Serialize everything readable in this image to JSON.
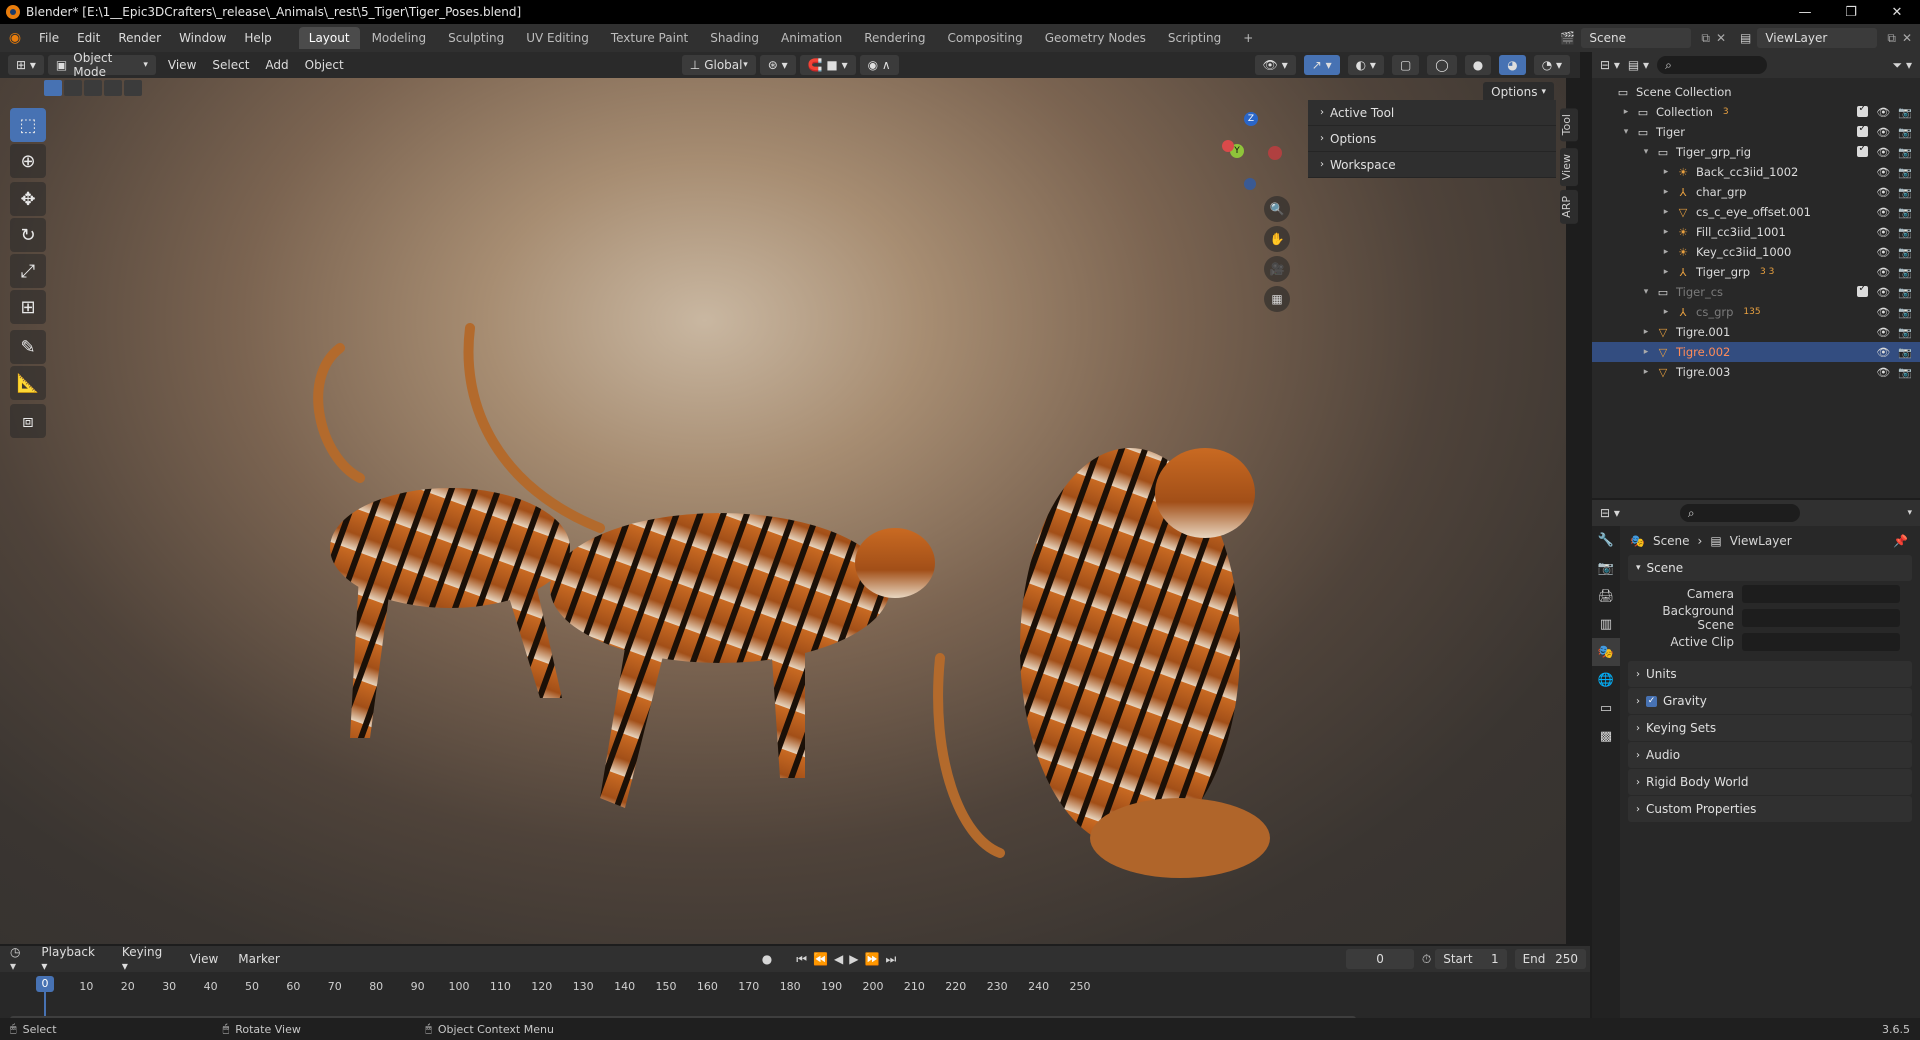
{
  "window": {
    "title": "Blender* [E:\\1__Epic3DCrafters\\_release\\_Animals\\_rest\\5_Tiger\\Tiger_Poses.blend]"
  },
  "menu": [
    "File",
    "Edit",
    "Render",
    "Window",
    "Help"
  ],
  "workspaces": [
    "Layout",
    "Modeling",
    "Sculpting",
    "UV Editing",
    "Texture Paint",
    "Shading",
    "Animation",
    "Rendering",
    "Compositing",
    "Geometry Nodes",
    "Scripting"
  ],
  "active_workspace": "Layout",
  "scene_field": "Scene",
  "viewlayer_field": "ViewLayer",
  "viewport_header": {
    "mode": "Object Mode",
    "menus": [
      "View",
      "Select",
      "Add",
      "Object"
    ],
    "orientation": "Global",
    "options_label": "Options"
  },
  "npanel": {
    "rows": [
      "Active Tool",
      "Options",
      "Workspace"
    ],
    "tabs": [
      "Tool",
      "View",
      "ARP"
    ]
  },
  "outliner": {
    "rows": [
      {
        "label": "Scene Collection",
        "icon": "collection-icon",
        "depth": 0,
        "expand": ""
      },
      {
        "label": "Collection",
        "icon": "collection-icon",
        "depth": 1,
        "expand": "▸",
        "badge": "3"
      },
      {
        "label": "Tiger",
        "icon": "collection-icon",
        "depth": 1,
        "expand": "▾"
      },
      {
        "label": "Tiger_grp_rig",
        "icon": "collection-icon",
        "depth": 2,
        "expand": "▾"
      },
      {
        "label": "Back_cc3iid_1002",
        "icon": "light-icon",
        "depth": 3,
        "expand": "▸"
      },
      {
        "label": "char_grp",
        "icon": "armature-icon",
        "depth": 3,
        "expand": "▸"
      },
      {
        "label": "cs_c_eye_offset.001",
        "icon": "mesh-icon",
        "depth": 3,
        "expand": "▸"
      },
      {
        "label": "Fill_cc3iid_1001",
        "icon": "light-icon",
        "depth": 3,
        "expand": "▸"
      },
      {
        "label": "Key_cc3iid_1000",
        "icon": "light-icon",
        "depth": 3,
        "expand": "▸"
      },
      {
        "label": "Tiger_grp",
        "icon": "armature-icon",
        "depth": 3,
        "expand": "▸",
        "badge": "3 3"
      },
      {
        "label": "Tiger_cs",
        "icon": "collection-icon",
        "depth": 2,
        "expand": "▾",
        "dim": true
      },
      {
        "label": "cs_grp",
        "icon": "armature-icon",
        "depth": 3,
        "expand": "▸",
        "dim": true,
        "badge": "135"
      },
      {
        "label": "Tigre.001",
        "icon": "mesh-icon",
        "depth": 2,
        "expand": "▸"
      },
      {
        "label": "Tigre.002",
        "icon": "mesh-icon",
        "depth": 2,
        "expand": "▸",
        "selected": true
      },
      {
        "label": "Tigre.003",
        "icon": "mesh-icon",
        "depth": 2,
        "expand": "▸"
      }
    ]
  },
  "properties": {
    "breadcrumb": [
      "Scene",
      "ViewLayer"
    ],
    "section": "Scene",
    "fields": [
      {
        "label": "Camera"
      },
      {
        "label": "Background Scene"
      },
      {
        "label": "Active Clip"
      }
    ],
    "panels": [
      "Units",
      "Gravity",
      "Keying Sets",
      "Audio",
      "Rigid Body World",
      "Custom Properties"
    ],
    "gravity_enabled": true
  },
  "timeline": {
    "menus": [
      "Playback",
      "Keying",
      "View",
      "Marker"
    ],
    "current_frame": "0",
    "start_label": "Start",
    "start": "1",
    "end_label": "End",
    "end": "250",
    "ticks": [
      "10",
      "20",
      "30",
      "40",
      "50",
      "60",
      "70",
      "80",
      "90",
      "100",
      "110",
      "120",
      "130",
      "140",
      "150",
      "160",
      "170",
      "180",
      "190",
      "200",
      "210",
      "220",
      "230",
      "240",
      "250"
    ]
  },
  "statusbar": {
    "items": [
      "Select",
      "Rotate View",
      "Object Context Menu"
    ],
    "version": "3.6.5"
  },
  "colors": {
    "accent": "#4772b3",
    "selected_row": "#334d80",
    "highlight_text": "#ff8c5a",
    "orange_icon": "#e8a040",
    "mesh_icon": "#7fc4c4"
  }
}
